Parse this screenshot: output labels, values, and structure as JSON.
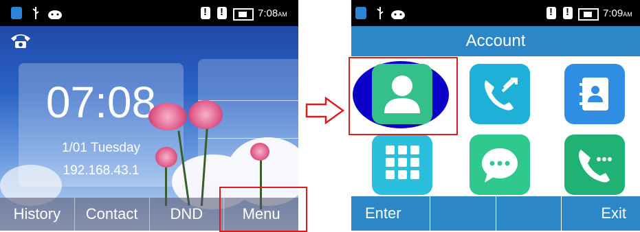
{
  "left_screen": {
    "status_time": "7:08",
    "status_ampm": "AM",
    "clock": "07:08",
    "date": "1/01 Tuesday",
    "ip": "192.168.43.1",
    "softkeys": [
      "History",
      "Contact",
      "DND",
      "Menu"
    ]
  },
  "right_screen": {
    "status_time": "7:09",
    "status_ampm": "AM",
    "title": "Account",
    "menu_icons": [
      "account-icon",
      "call-feature-icon",
      "directory-icon",
      "dial-pad-icon",
      "messages-icon",
      "call-history-icon"
    ],
    "softkeys": [
      "Enter",
      "",
      "",
      "Exit"
    ]
  },
  "colors": {
    "title_bar": "#2b87c8",
    "highlight": "#0b00c8",
    "annotation_red": "#e11b1b"
  }
}
